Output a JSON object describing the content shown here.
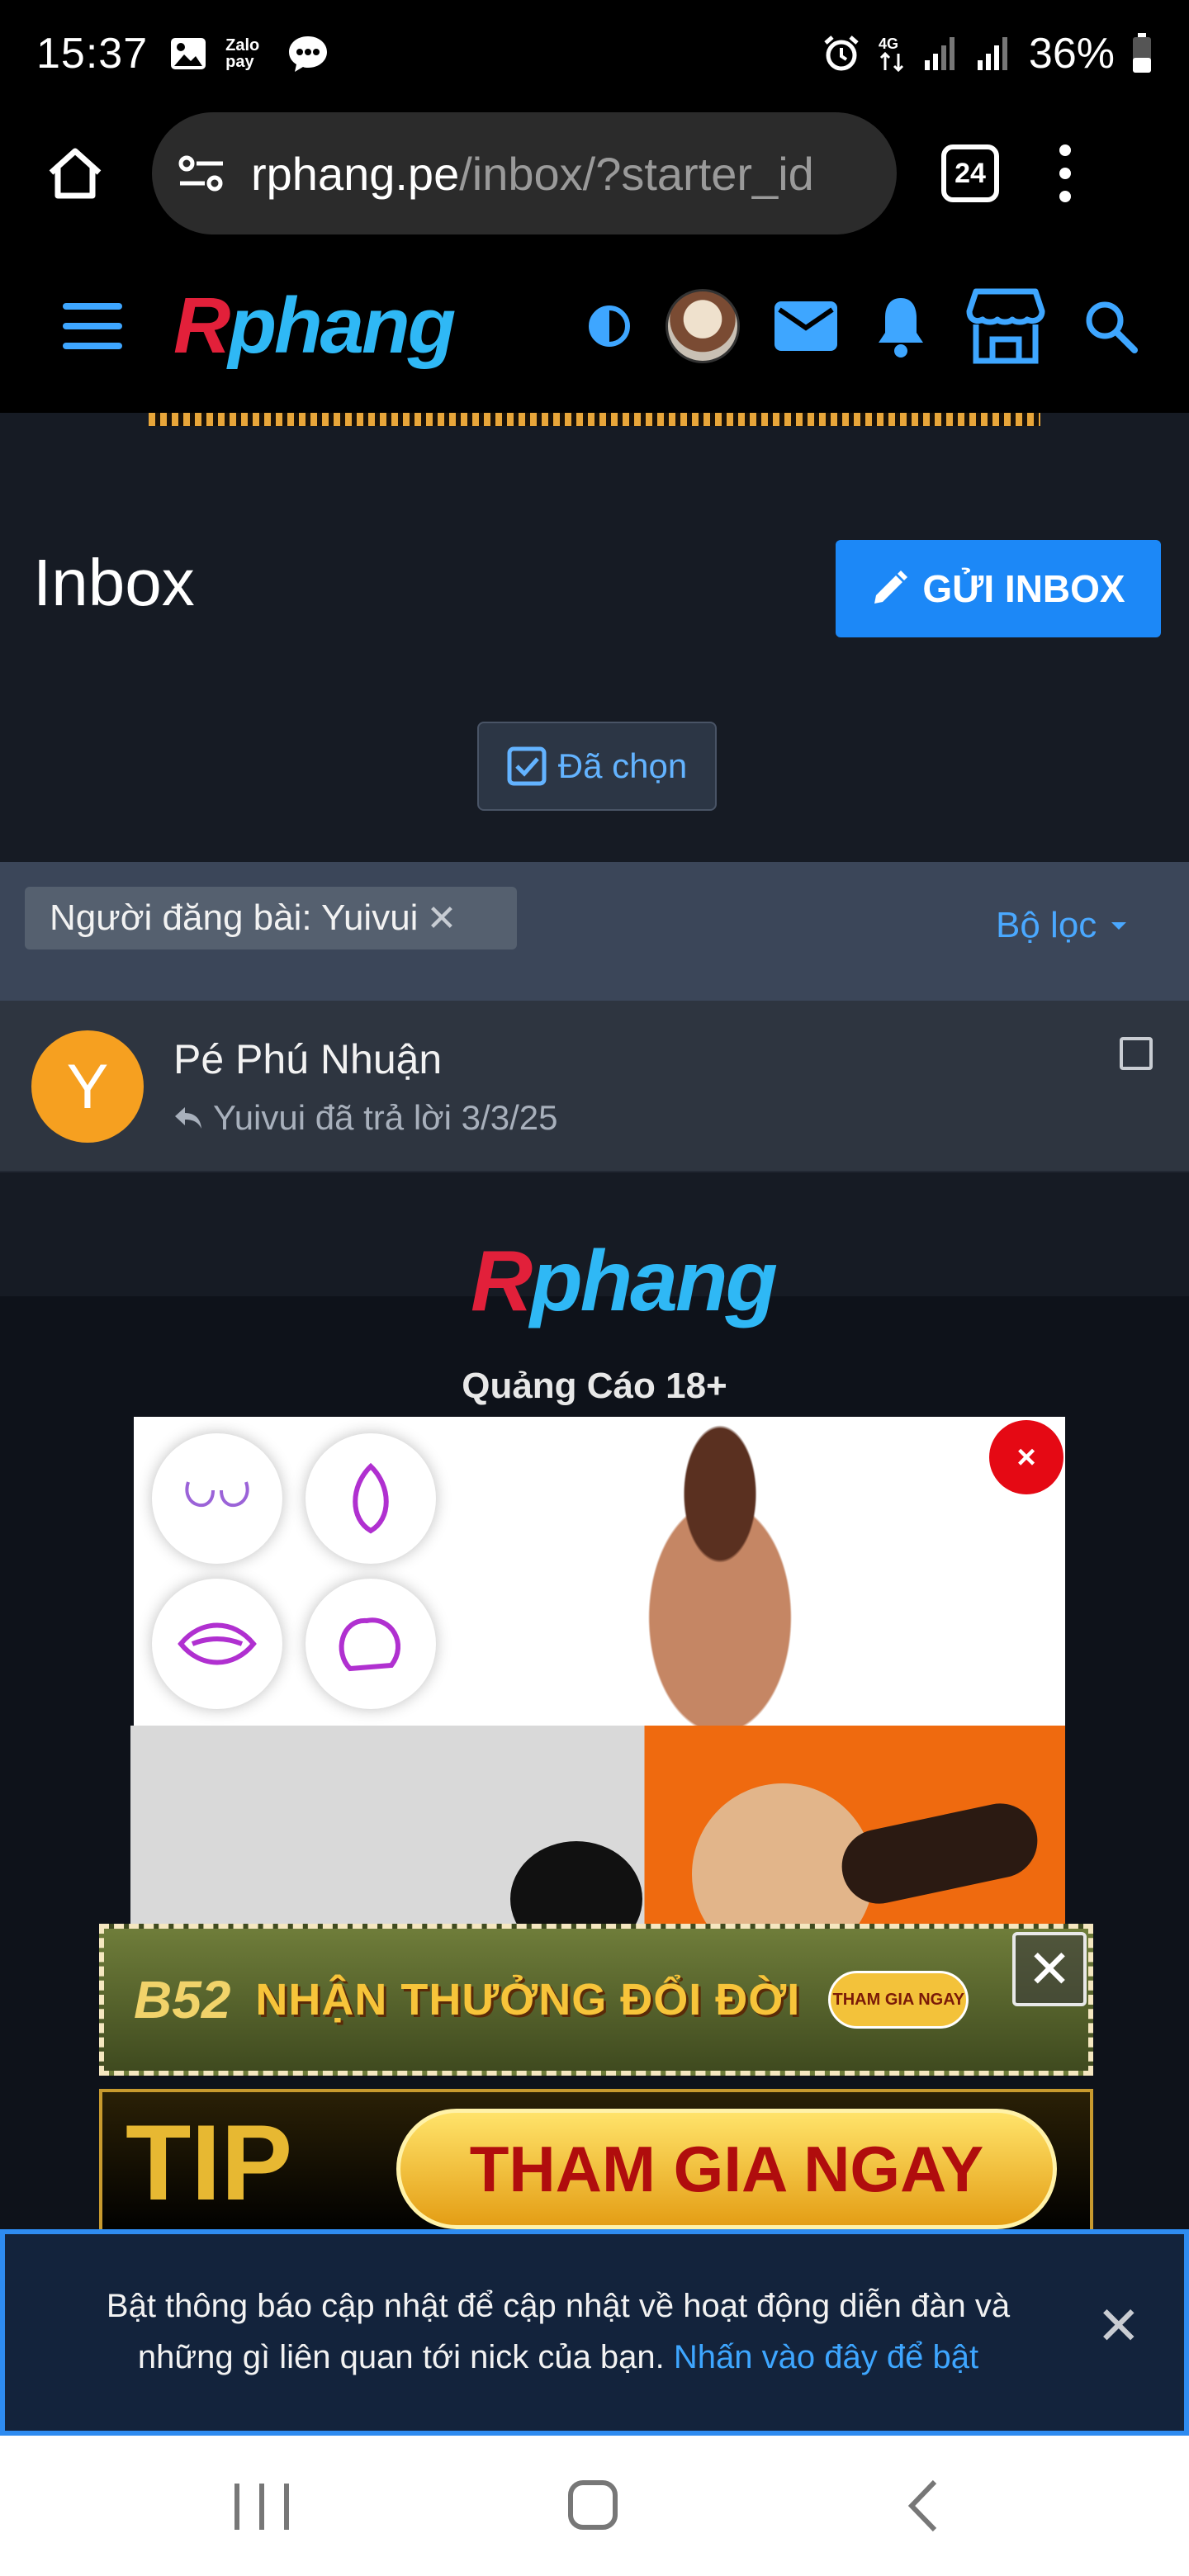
{
  "status_bar": {
    "time": "15:37",
    "zalopay_label": "Zalo pay",
    "network": "4G",
    "battery_percent": "36%"
  },
  "browser": {
    "url_host": "rphang.pe",
    "url_path": "/inbox/?starter_id",
    "tab_count": "24"
  },
  "site_header": {
    "logo_initial": "R",
    "logo_rest": "phang"
  },
  "inbox": {
    "title": "Inbox",
    "send_button_label": "GỬI INBOX",
    "selected_button_label": "Đã chọn"
  },
  "filter": {
    "chip_label": "Người đăng bài: Yuivui",
    "chip_close": "✕",
    "dropdown_label": "Bộ lọc"
  },
  "conversation": {
    "avatar_letter": "Y",
    "title": "Pé Phú Nhuận",
    "meta": "Yuivui đã trả lời 3/3/25"
  },
  "ads": {
    "logo_initial": "R",
    "logo_rest": "phang",
    "label": "Quảng Cáo 18+",
    "close_label": "×",
    "b52_logo": "B52",
    "b52_text": "NHẬN THƯỞNG ĐỔI ĐỜI",
    "b52_cta": "THAM GIA NGAY",
    "b52_close": "✕",
    "tip_logo": "TIP",
    "tip_cta": "THAM GIA NGAY"
  },
  "notification": {
    "text": "Bật thông báo cập nhật để cập nhật về hoạt động diễn đàn và những gì liên quan tới nick của bạn.",
    "link": "Nhấn vào đây để bật",
    "close": "✕"
  },
  "colors": {
    "accent": "#1c88f7",
    "link": "#3ea6ff",
    "page_bg": "#161b24",
    "filter_bg": "#3b4659",
    "avatar": "#f6a020"
  }
}
